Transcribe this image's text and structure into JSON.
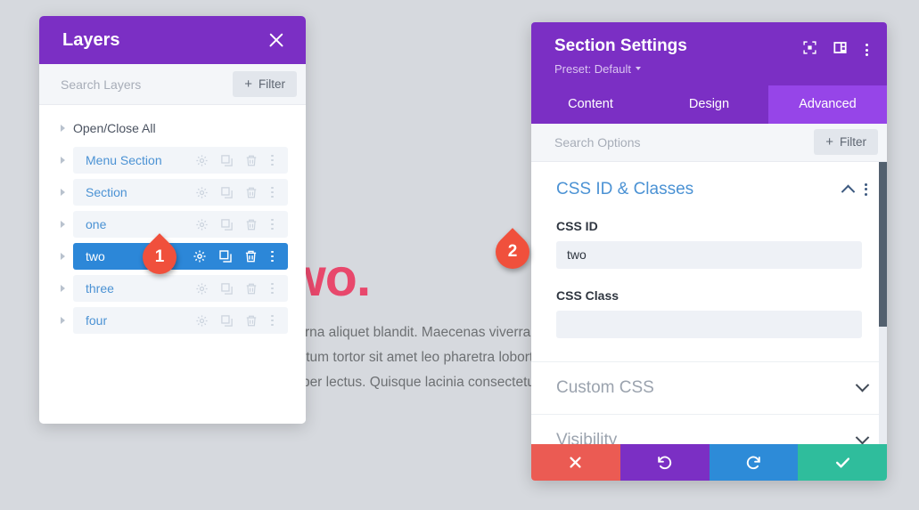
{
  "canvas": {
    "heading": "Step Two.",
    "heading_color": "#e8486c",
    "paragraph": "Curabitur blandit risus a urna aliquet blandit. Maecenas viverra lectus sit amet felis rutrum, blandit elementum tortor sit amet leo pharetra lobortis sed a gravida nibh id, semper lectus. Quisque lacinia consectetur.",
    "background_color": "#d6d9de"
  },
  "layers_panel": {
    "title": "Layers",
    "close_icon": "close-icon",
    "search": {
      "placeholder": "Search Layers",
      "value": ""
    },
    "filter_button": {
      "label": "Filter",
      "plus": "+"
    },
    "open_close_all": "Open/Close All",
    "row_icons": [
      "gear-icon",
      "duplicate-icon",
      "trash-icon",
      "more-vertical-icon"
    ],
    "rows": [
      {
        "label": "Menu Section",
        "selected": false
      },
      {
        "label": "Section",
        "selected": false
      },
      {
        "label": "one",
        "selected": false
      },
      {
        "label": "two",
        "selected": true
      },
      {
        "label": "three",
        "selected": false
      },
      {
        "label": "four",
        "selected": false
      }
    ],
    "selected_row_color": "#2c87d8",
    "header_color": "#7b2fc4"
  },
  "settings_panel": {
    "title": "Section Settings",
    "preset": "Preset: Default",
    "header_icons": [
      "focus-target-icon",
      "panel-layout-icon",
      "more-vertical-icon"
    ],
    "tabs": [
      {
        "label": "Content",
        "active": false
      },
      {
        "label": "Design",
        "active": false
      },
      {
        "label": "Advanced",
        "active": true
      }
    ],
    "search": {
      "placeholder": "Search Options",
      "value": ""
    },
    "filter_button": {
      "label": "Filter",
      "plus": "+"
    },
    "groups": [
      {
        "title": "CSS ID & Classes",
        "expanded": true,
        "fields": [
          {
            "label": "CSS ID",
            "value": "two",
            "placeholder": ""
          },
          {
            "label": "CSS Class",
            "value": "",
            "placeholder": ""
          }
        ]
      },
      {
        "title": "Custom CSS",
        "expanded": false
      },
      {
        "title": "Visibility",
        "expanded": false
      }
    ],
    "action_buttons": [
      {
        "name": "cancel",
        "icon": "close-icon",
        "color": "#eb5b53"
      },
      {
        "name": "undo",
        "icon": "undo-icon",
        "color": "#7b2fc4"
      },
      {
        "name": "redo",
        "icon": "redo-icon",
        "color": "#2d8bd8"
      },
      {
        "name": "save",
        "icon": "check-icon",
        "color": "#2fbd9c"
      }
    ],
    "header_color": "#7b2fc4",
    "active_tab_color": "#9645e8"
  },
  "callouts": [
    {
      "number": "1",
      "color": "#f0503c"
    },
    {
      "number": "2",
      "color": "#f0503c"
    }
  ]
}
